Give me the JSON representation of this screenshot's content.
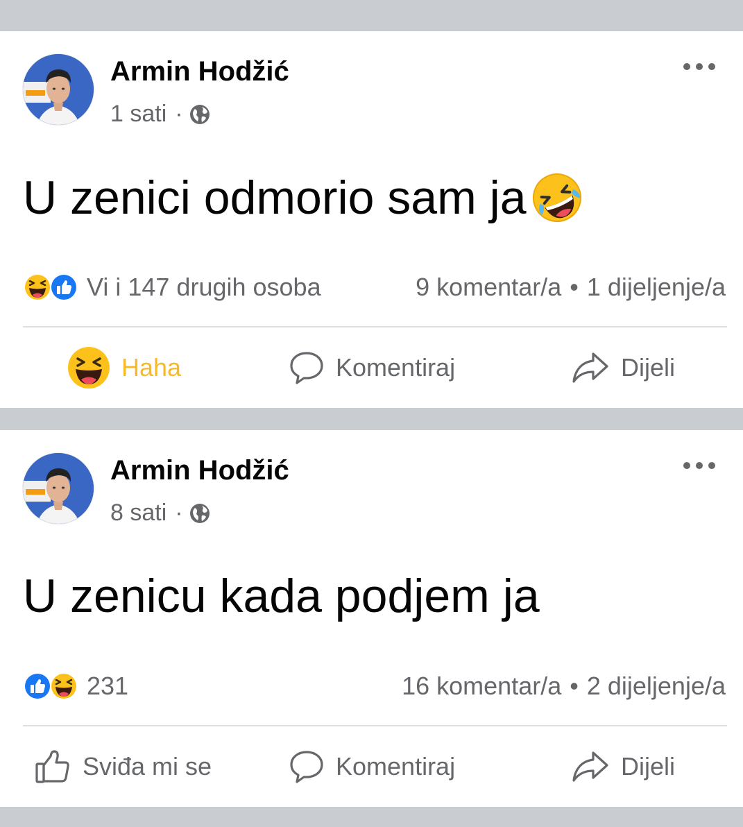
{
  "posts": [
    {
      "author": "Armin Hodžić",
      "time": "1 sati",
      "separator": "·",
      "text": "U zenici odmorio sam ja",
      "reactions_label": "Vi i 147 drugih osoba",
      "comments": "9 komentar/a",
      "shares": "1 dijeljenje/a",
      "actions": {
        "react": "Haha",
        "comment": "Komentiraj",
        "share": "Dijeli"
      },
      "icons": {
        "react": "haha-icon",
        "text_emoji": "rofl-emoji"
      }
    },
    {
      "author": "Armin Hodžić",
      "time": "8 sati",
      "separator": "·",
      "text": "U zenicu kada podjem ja",
      "reactions_label": "231",
      "comments": "16 komentar/a",
      "shares": "2 dijeljenje/a",
      "actions": {
        "react": "Sviđa mi se",
        "comment": "Komentiraj",
        "share": "Dijeli"
      },
      "icons": {
        "react": "thumbs-up-outline-icon"
      }
    }
  ],
  "bullet": "•",
  "colors": {
    "haha_active": "#f7b928",
    "like_blue": "#1877f2",
    "secondary_text": "#65676b",
    "feed_background": "#c9ccd1"
  }
}
